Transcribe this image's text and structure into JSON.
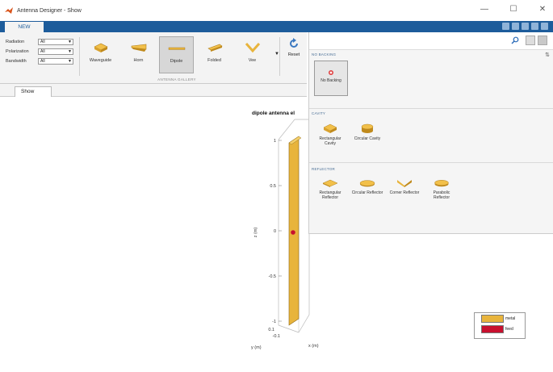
{
  "window": {
    "title": "Antenna Designer - Show",
    "controls": [
      "—",
      "☐",
      "✕"
    ]
  },
  "tabs": {
    "new_label": "NEW"
  },
  "filters": [
    {
      "label": "Radiation",
      "value": "All"
    },
    {
      "label": "Polarization",
      "value": "All"
    },
    {
      "label": "Bandwidth",
      "value": "All"
    }
  ],
  "gallery": {
    "section_label": "ANTENNA GALLERY",
    "items": [
      {
        "label": "Waveguide",
        "icon": "waveguide-icon"
      },
      {
        "label": "Horn",
        "icon": "horn-icon"
      },
      {
        "label": "Dipole",
        "icon": "dipole-icon",
        "selected": true
      },
      {
        "label": "Folded",
        "icon": "folded-icon"
      },
      {
        "label": "Vee",
        "icon": "vee-icon"
      }
    ],
    "reset_label": "Reset"
  },
  "document": {
    "tab_label": "Show"
  },
  "panel": {
    "sections": [
      {
        "header": "NO BACKING",
        "items": [
          {
            "label": "No Backing",
            "icon": "no-backing-icon"
          }
        ]
      },
      {
        "header": "CAVITY",
        "items": [
          {
            "label": "Rectangular Cavity",
            "icon": "rectangular-cavity-icon"
          },
          {
            "label": "Circular Cavity",
            "icon": "circular-cavity-icon"
          }
        ]
      },
      {
        "header": "REFLECTOR",
        "items": [
          {
            "label": "Rectangular Reflector",
            "icon": "rectangular-reflector-icon"
          },
          {
            "label": "Circular Reflector",
            "icon": "circular-reflector-icon"
          },
          {
            "label": "Corner Reflector",
            "icon": "corner-reflector-icon"
          },
          {
            "label": "Parabolic Reflector",
            "icon": "parabolic-reflector-icon"
          }
        ]
      }
    ]
  },
  "plot": {
    "title": "dipole antenna el",
    "zlabel": "z (m)",
    "ylabel": "y (m)",
    "xlabel": "x (m)",
    "z_ticks": [
      "1",
      "0.5",
      "0",
      "-0.5",
      "-1"
    ],
    "y_ticks": [
      "0.1",
      "-0.1"
    ],
    "legend": [
      {
        "label": "metal",
        "color": "#e8b43c"
      },
      {
        "label": "feed",
        "color": "#c8102e"
      }
    ]
  },
  "colors": {
    "accent": "#1d5c9b",
    "metal": "#e8b43c",
    "feed": "#c8102e"
  }
}
